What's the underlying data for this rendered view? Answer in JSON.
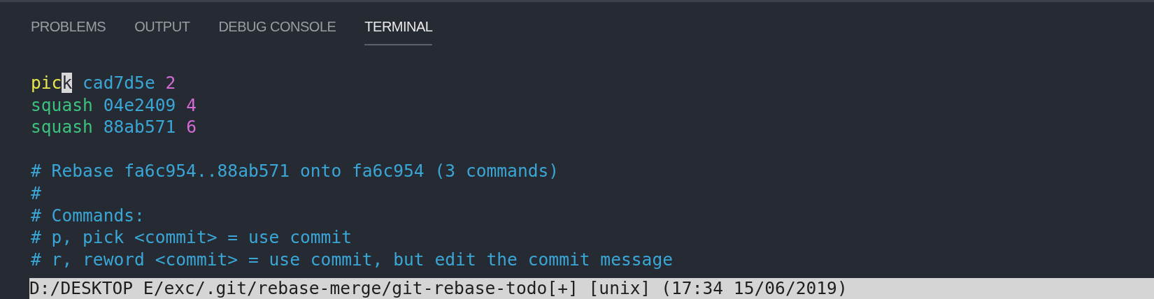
{
  "tabs": [
    {
      "label": "PROBLEMS",
      "selected": false
    },
    {
      "label": "OUTPUT",
      "selected": false
    },
    {
      "label": "DEBUG CONSOLE",
      "selected": false
    },
    {
      "label": "TERMINAL",
      "selected": true
    }
  ],
  "terminal": {
    "lines": [
      {
        "kind": "code",
        "segments": [
          {
            "kind": "text",
            "text": "pic",
            "color": "#e6e64a"
          },
          {
            "kind": "cursor",
            "text": "k"
          },
          {
            "kind": "text",
            "text": " cad7d5e ",
            "color": "#3aa6d6"
          },
          {
            "kind": "text",
            "text": "2",
            "color": "#d36ad6"
          }
        ]
      },
      {
        "kind": "code",
        "segments": [
          {
            "kind": "text",
            "text": "squash ",
            "color": "#3cc27e"
          },
          {
            "kind": "text",
            "text": "04e2409 ",
            "color": "#3aa6d6"
          },
          {
            "kind": "text",
            "text": "4",
            "color": "#d36ad6"
          }
        ]
      },
      {
        "kind": "code",
        "segments": [
          {
            "kind": "text",
            "text": "squash ",
            "color": "#3cc27e"
          },
          {
            "kind": "text",
            "text": "88ab571 ",
            "color": "#3aa6d6"
          },
          {
            "kind": "text",
            "text": "6",
            "color": "#d36ad6"
          }
        ]
      },
      {
        "kind": "blank"
      },
      {
        "kind": "code",
        "segments": [
          {
            "kind": "text",
            "text": "# Rebase fa6c954..88ab571 onto fa6c954 (3 commands)",
            "color": "#3aa6d6"
          }
        ]
      },
      {
        "kind": "code",
        "segments": [
          {
            "kind": "text",
            "text": "#",
            "color": "#3aa6d6"
          }
        ]
      },
      {
        "kind": "code",
        "segments": [
          {
            "kind": "text",
            "text": "# Commands:",
            "color": "#3aa6d6"
          }
        ]
      },
      {
        "kind": "code",
        "segments": [
          {
            "kind": "text",
            "text": "# p, pick <commit> = use commit",
            "color": "#3aa6d6"
          }
        ]
      },
      {
        "kind": "code",
        "segments": [
          {
            "kind": "text",
            "text": "# r, reword <commit> = use commit, but edit the commit message",
            "color": "#3aa6d6"
          }
        ]
      }
    ]
  },
  "status_bar": {
    "text": "D:/DESKTOP E/exc/.git/rebase-merge/git-rebase-todo[+] [unix] (17:34 15/06/2019)"
  }
}
